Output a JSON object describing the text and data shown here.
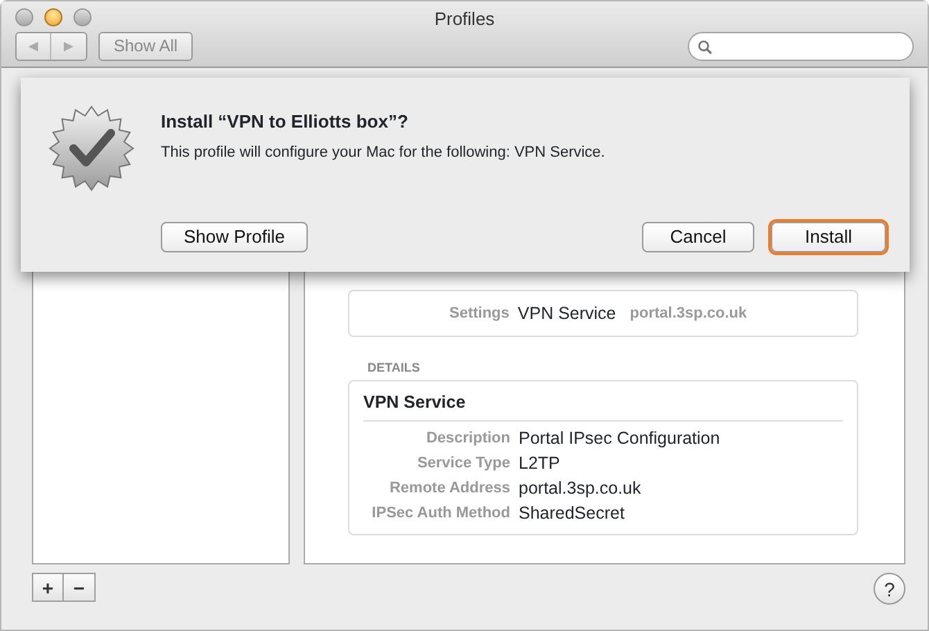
{
  "window": {
    "title": "Profiles"
  },
  "toolbar": {
    "back": "◀",
    "forward": "▶",
    "show_all": "Show All"
  },
  "sheet": {
    "title": "Install “VPN to Elliotts box”?",
    "message": "This profile will configure your Mac for the following: VPN Service.",
    "buttons": [
      {
        "label": "Show Profile",
        "focused": false
      },
      {
        "label": "Cancel",
        "focused": false
      },
      {
        "label": "Install",
        "focused": true
      }
    ]
  },
  "settings": {
    "label": "Settings",
    "value": "VPN Service",
    "detail": "portal.3sp.co.uk"
  },
  "details": {
    "heading": "DETAILS",
    "title": "VPN Service",
    "rows": [
      {
        "label": "Description",
        "value": "Portal IPsec Configuration"
      },
      {
        "label": "Service Type",
        "value": "L2TP"
      },
      {
        "label": "Remote Address",
        "value": "portal.3sp.co.uk"
      },
      {
        "label": "IPSec Auth Method",
        "value": "SharedSecret"
      }
    ]
  },
  "bottom": {
    "add": "+",
    "remove": "−",
    "help": "?"
  }
}
